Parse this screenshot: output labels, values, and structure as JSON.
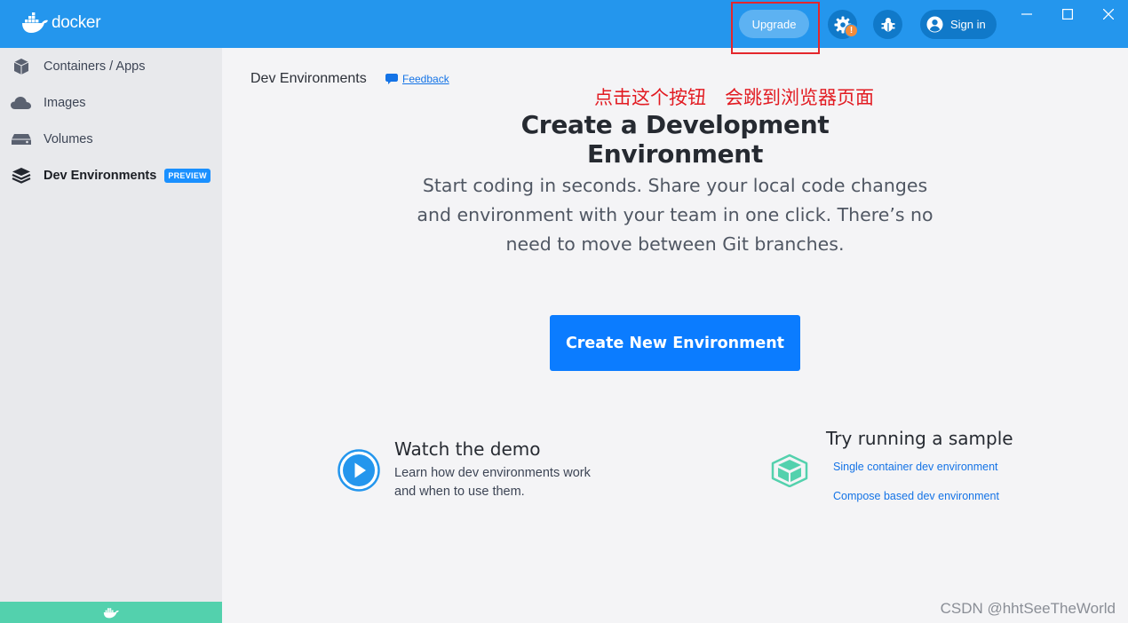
{
  "header": {
    "logo_text": "docker",
    "upgrade_label": "Upgrade",
    "warning_badge": "!",
    "signin_label": "Sign in",
    "icons": [
      "whale-logo-icon",
      "gear-icon",
      "bug-icon",
      "user-circle-icon",
      "minimize-icon",
      "maximize-icon",
      "close-icon"
    ]
  },
  "sidebar": {
    "items": [
      {
        "label": "Containers / Apps",
        "icon": "cube-icon"
      },
      {
        "label": "Images",
        "icon": "cloud-icon"
      },
      {
        "label": "Volumes",
        "icon": "drive-icon"
      },
      {
        "label": "Dev Environments",
        "icon": "stack-icon",
        "badge": "PREVIEW",
        "active": true
      }
    ]
  },
  "page": {
    "breadcrumb": "Dev Environments",
    "feedback_label": "Feedback",
    "annotation": "点击这个按钮　会跳到浏览器页面",
    "title": "Create a Development Environment",
    "description_lines": [
      "Start coding in seconds. Share your local code changes",
      "and environment with your team in one click. There’s no",
      "need to move between Git branches."
    ],
    "create_button_label": "Create New Environment",
    "demo": {
      "title": "Watch the demo",
      "description_lines": [
        "Learn how dev environments work",
        "and when to use them."
      ]
    },
    "sample": {
      "title": "Try running a sample",
      "links": [
        "Single container dev environment",
        "Compose based dev environment"
      ]
    }
  },
  "watermark": "CSDN @hhtSeeTheWorld",
  "colors": {
    "header_blue": "#2496ed",
    "primary_button": "#0b7cff",
    "link_blue": "#1473e6",
    "annotation_red": "#e21b22",
    "sidebar_footer_green": "#53d1ad",
    "warning_orange": "#f28b3a"
  }
}
